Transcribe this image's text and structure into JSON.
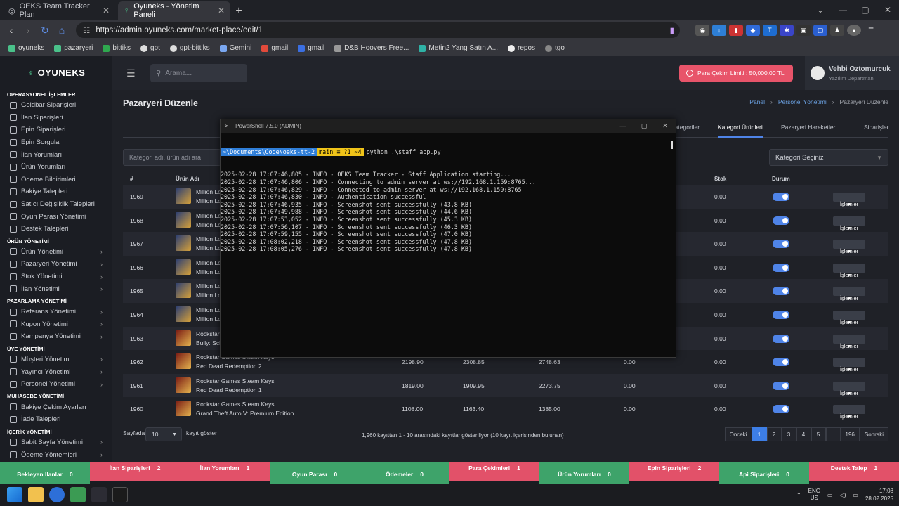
{
  "browser": {
    "tabs": [
      {
        "title": "OEKS Team Tracker Plan",
        "active": false
      },
      {
        "title": "Oyuneks - Yönetim Paneli",
        "active": true
      }
    ],
    "url": "https://admin.oyuneks.com/market-place/edit/1",
    "bookmarks": [
      "oyuneks",
      "pazaryeri",
      "bittiks",
      "gpt",
      "gpt-bittiks",
      "Gemini",
      "gmail",
      "gmail",
      "D&B Hoovers Free...",
      "Metin2 Yang Satın A...",
      "repos",
      "tgo"
    ]
  },
  "sidebar": {
    "logo": "OYUNEKS",
    "sections": [
      {
        "title": "OPERASYONEL İŞLEMLER",
        "items": [
          {
            "label": "Goldbar Siparişleri",
            "arrow": false
          },
          {
            "label": "İlan Siparişleri",
            "arrow": false
          },
          {
            "label": "Epin Siparişleri",
            "arrow": false
          },
          {
            "label": "Epin Sorgula",
            "arrow": false
          },
          {
            "label": "İlan Yorumları",
            "arrow": false
          },
          {
            "label": "Ürün Yorumları",
            "arrow": false
          },
          {
            "label": "Ödeme Bildirimleri",
            "arrow": false
          },
          {
            "label": "Bakiye Talepleri",
            "arrow": false
          },
          {
            "label": "Satıcı Değişiklik Talepleri",
            "arrow": false
          },
          {
            "label": "Oyun Parası Yönetimi",
            "arrow": false
          },
          {
            "label": "Destek Talepleri",
            "arrow": false
          }
        ]
      },
      {
        "title": "ÜRÜN YÖNETİMİ",
        "items": [
          {
            "label": "Ürün Yönetimi",
            "arrow": true
          },
          {
            "label": "Pazaryeri Yönetimi",
            "arrow": true
          },
          {
            "label": "Stok Yönetimi",
            "arrow": true
          },
          {
            "label": "İlan Yönetimi",
            "arrow": true
          }
        ]
      },
      {
        "title": "PAZARLAMA YÖNETİMİ",
        "items": [
          {
            "label": "Referans Yönetimi",
            "arrow": true
          },
          {
            "label": "Kupon Yönetimi",
            "arrow": true
          },
          {
            "label": "Kampanya Yönetimi",
            "arrow": true
          }
        ]
      },
      {
        "title": "ÜYE YÖNETİMİ",
        "items": [
          {
            "label": "Müşteri Yönetimi",
            "arrow": true
          },
          {
            "label": "Yayıncı Yönetimi",
            "arrow": true
          },
          {
            "label": "Personel Yönetimi",
            "arrow": true
          }
        ]
      },
      {
        "title": "MUHASEBE YÖNETİMİ",
        "items": [
          {
            "label": "Bakiye Çekim Ayarları",
            "arrow": false
          },
          {
            "label": "İade Talepleri",
            "arrow": false
          }
        ]
      },
      {
        "title": "İÇERİK YÖNETİMİ",
        "items": [
          {
            "label": "Sabit Sayfa Yönetimi",
            "arrow": true
          },
          {
            "label": "Ödeme Yöntemleri",
            "arrow": true
          }
        ]
      }
    ]
  },
  "topbar": {
    "search_placeholder": "Arama...",
    "limit_label": "Para Çekim Limiti : 50,000.00 TL",
    "user_name": "Vehbi Oztomurcuk",
    "user_dept": "Yazılım Departmanı"
  },
  "page": {
    "title": "Pazaryeri Düzenle",
    "breadcrumb": [
      "Panel",
      "Personel Yönetimi",
      "Pazaryeri Düzenle"
    ],
    "tabs": [
      "Kategoriler",
      "Kategori Ürünleri",
      "Pazaryeri Hareketleri",
      "Siparişler"
    ],
    "filter_placeholder": "Kategori adı, ürün adı ara",
    "category_select": "Kategori Seçiniz",
    "columns": {
      "id": "#",
      "name": "Ürün Adı",
      "stock": "Stok",
      "status": "Durum"
    },
    "ops_label": "İşlemler",
    "rows": [
      {
        "id": "1969",
        "l1": "Million Lo",
        "l2": "Million Lo",
        "c1": "",
        "c2": "",
        "c3": "",
        "c4": "",
        "stock": "0.00",
        "kind": "ml"
      },
      {
        "id": "1968",
        "l1": "Million Lo",
        "l2": "Million Lo",
        "c1": "",
        "c2": "",
        "c3": "",
        "c4": "",
        "stock": "0.00",
        "kind": "ml"
      },
      {
        "id": "1967",
        "l1": "Million Lo",
        "l2": "Million Lo",
        "c1": "",
        "c2": "",
        "c3": "",
        "c4": "",
        "stock": "0.00",
        "kind": "ml"
      },
      {
        "id": "1966",
        "l1": "Million Lo",
        "l2": "Million Lo",
        "c1": "",
        "c2": "",
        "c3": "",
        "c4": "",
        "stock": "0.00",
        "kind": "ml"
      },
      {
        "id": "1965",
        "l1": "Million Lo",
        "l2": "Million Lo",
        "c1": "",
        "c2": "",
        "c3": "",
        "c4": "",
        "stock": "0.00",
        "kind": "ml"
      },
      {
        "id": "1964",
        "l1": "Million Lo",
        "l2": "Million Lo",
        "c1": "",
        "c2": "",
        "c3": "",
        "c4": "",
        "stock": "0.00",
        "kind": "ml"
      },
      {
        "id": "1963",
        "l1": "Rockstar",
        "l2": "Bully: Sch",
        "c1": "",
        "c2": "",
        "c3": "",
        "c4": "",
        "stock": "0.00",
        "kind": "rs"
      },
      {
        "id": "1962",
        "l1": "Rockstar Games Steam Keys",
        "l2": "Red Dead Redemption 2",
        "c1": "2198.90",
        "c2": "2308.85",
        "c3": "2748.63",
        "c4": "0.00",
        "stock": "0.00",
        "kind": "rs"
      },
      {
        "id": "1961",
        "l1": "Rockstar Games Steam Keys",
        "l2": "Red Dead Redemption 1",
        "c1": "1819.00",
        "c2": "1909.95",
        "c3": "2273.75",
        "c4": "0.00",
        "stock": "0.00",
        "kind": "rs"
      },
      {
        "id": "1960",
        "l1": "Rockstar Games Steam Keys",
        "l2": "Grand Theft Auto V: Premium Edition",
        "c1": "1108.00",
        "c2": "1163.40",
        "c3": "1385.00",
        "c4": "0.00",
        "stock": "0.00",
        "kind": "rs"
      }
    ],
    "pager": {
      "prefix": "Sayfada",
      "per_page": "10",
      "suffix": "kayıt göster",
      "info": "1,960 kayıttan 1 - 10 arasındaki kayıtlar gösteriliyor (10 kayıt içerisinden bulunan)",
      "prev": "Önceki",
      "pages": [
        "1",
        "2",
        "3",
        "4",
        "5",
        "...",
        "196"
      ],
      "next": "Sonraki"
    }
  },
  "powershell": {
    "title": "PowerShell 7.5.0 (ADMIN)",
    "prompt_path": "~\\Documents\\Code\\oeks-tt-2",
    "prompt_git": "main ≡ ?1 ~4",
    "command": "python .\\staff_app.py",
    "lines": [
      "2025-02-28 17:07:46,805 - INFO - OEKS Team Tracker - Staff Application starting...",
      "2025-02-28 17:07:46,806 - INFO - Connecting to admin server at ws://192.168.1.159:8765...",
      "2025-02-28 17:07:46,829 - INFO - Connected to admin server at ws://192.168.1.159:8765",
      "2025-02-28 17:07:46,830 - INFO - Authentication successful",
      "2025-02-28 17:07:46,935 - INFO - Screenshot sent successfully (43.8 KB)",
      "2025-02-28 17:07:49,988 - INFO - Screenshot sent successfully (44.6 KB)",
      "2025-02-28 17:07:53,052 - INFO - Screenshot sent successfully (45.3 KB)",
      "2025-02-28 17:07:56,107 - INFO - Screenshot sent successfully (46.3 KB)",
      "2025-02-28 17:07:59,155 - INFO - Screenshot sent successfully (47.0 KB)",
      "2025-02-28 17:08:02,218 - INFO - Screenshot sent successfully (47.8 KB)",
      "2025-02-28 17:08:05,276 - INFO - Screenshot sent successfully (47.8 KB)"
    ]
  },
  "statusbar": [
    {
      "label": "Bekleyen İlanlar",
      "count": "0",
      "color": "green"
    },
    {
      "label": "İlan Siparişleri",
      "count": "2",
      "color": "red"
    },
    {
      "label": "İlan Yorumları",
      "count": "1",
      "color": "red"
    },
    {
      "label": "Oyun Parası",
      "count": "0",
      "color": "green"
    },
    {
      "label": "Ödemeler",
      "count": "0",
      "color": "green"
    },
    {
      "label": "Para Çekimleri",
      "count": "1",
      "color": "red"
    },
    {
      "label": "Ürün Yorumları",
      "count": "0",
      "color": "green"
    },
    {
      "label": "Epin Siparişleri",
      "count": "2",
      "color": "red"
    },
    {
      "label": "Api Siparişleri",
      "count": "0",
      "color": "green"
    },
    {
      "label": "Destek Talep",
      "count": "1",
      "color": "red"
    }
  ],
  "taskbar": {
    "lang1": "ENG",
    "lang2": "US",
    "time": "17:08",
    "date": "28.02.2025"
  },
  "colors": {
    "accent": "#4f84e8",
    "green": "#3ea36a",
    "red": "#e25169",
    "limit": "#e8546a"
  }
}
